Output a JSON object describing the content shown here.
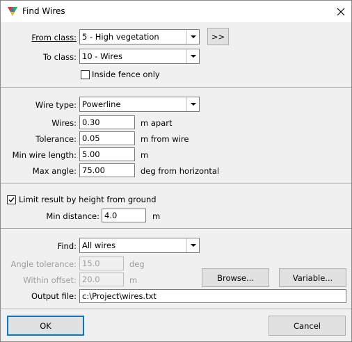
{
  "window": {
    "title": "Find Wires",
    "icon": "tri-color-app-icon",
    "close_icon": "close-icon"
  },
  "classes": {
    "from_label": "From class:",
    "from_value": "5 - High vegetation",
    "to_label": "To class:",
    "to_value": "10 - Wires",
    "swap_button": ">>",
    "inside_fence_label": "Inside fence only",
    "inside_fence_checked": false
  },
  "wire": {
    "type_label": "Wire type:",
    "type_value": "Powerline",
    "wires_label": "Wires:",
    "wires_value": "0.30",
    "wires_unit": "m apart",
    "tolerance_label": "Tolerance:",
    "tolerance_value": "0.05",
    "tolerance_unit": "m from wire",
    "min_length_label": "Min wire length:",
    "min_length_value": "5.00",
    "min_length_unit": "m",
    "max_angle_label": "Max angle:",
    "max_angle_value": "75.00",
    "max_angle_unit": "deg from horizontal"
  },
  "ground": {
    "limit_label": "Limit result by height from ground",
    "limit_checked": true,
    "min_distance_label": "Min distance:",
    "min_distance_value": "4.0",
    "min_distance_unit": "m"
  },
  "find": {
    "find_label": "Find:",
    "find_value": "All wires",
    "angle_tol_label": "Angle tolerance:",
    "angle_tol_value": "15.0",
    "angle_tol_unit": "deg",
    "within_offset_label": "Within offset:",
    "within_offset_value": "20.0",
    "within_offset_unit": "m",
    "browse_button": "Browse...",
    "variable_button": "Variable...",
    "output_label": "Output file:",
    "output_value": "c:\\Project\\wires.txt"
  },
  "footer": {
    "ok_button": "OK",
    "cancel_button": "Cancel"
  },
  "colors": {
    "accent": "#0078d7",
    "window_bg": "#f0f0f0",
    "titlebar_bg": "#ffffff",
    "disabled_text": "#9c9c9c"
  }
}
